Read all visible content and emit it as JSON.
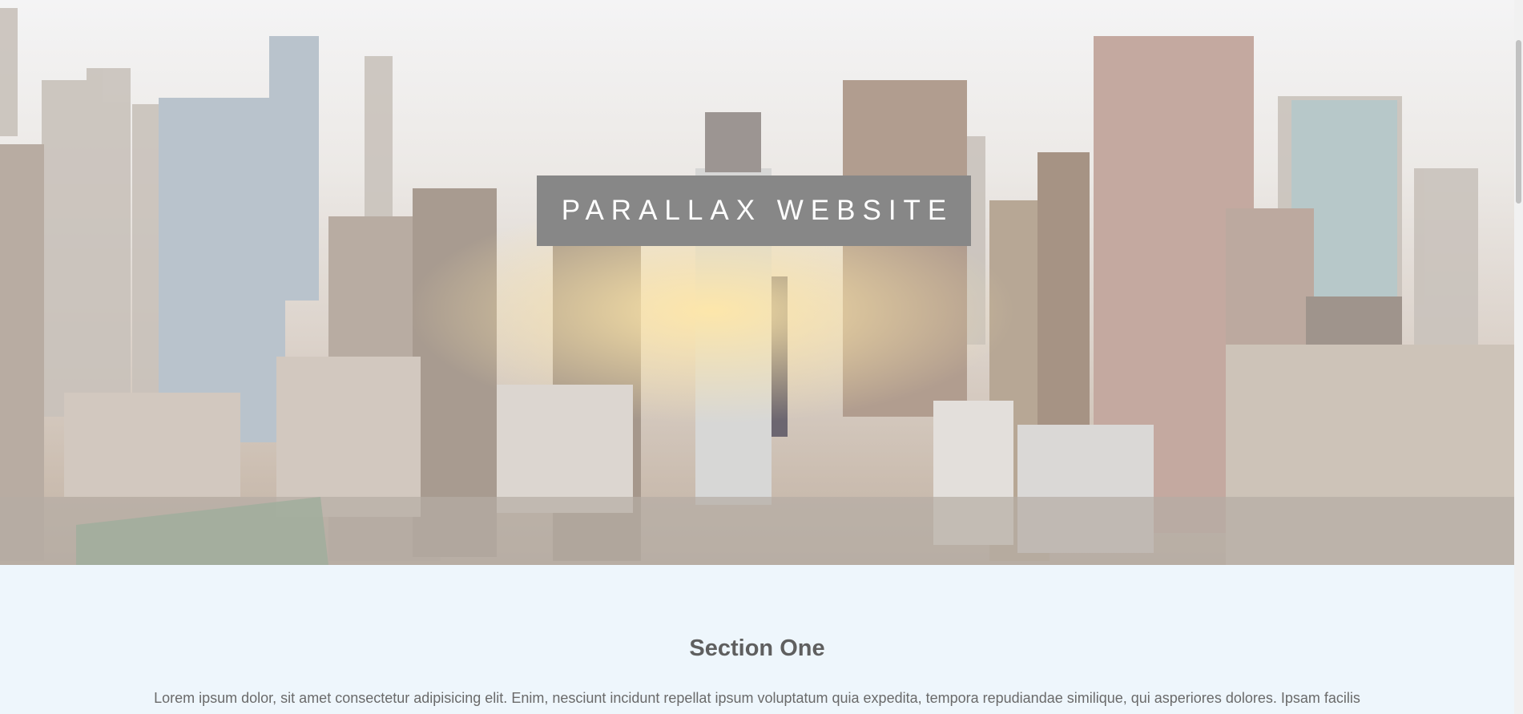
{
  "hero": {
    "title": "PARALLAX WEBSITE",
    "background_image": "city-skyline-sunrise"
  },
  "section_one": {
    "heading": "Section One",
    "body": "Lorem ipsum dolor, sit amet consectetur adipisicing elit. Enim, nesciunt incidunt repellat ipsum voluptatum quia expedita, tempora repudiandae similique, qui asperiores dolores. Ipsam facilis"
  },
  "colors": {
    "title_box": "#878787",
    "section_bg": "#eef6fc",
    "heading_text": "#5f5f5f"
  }
}
